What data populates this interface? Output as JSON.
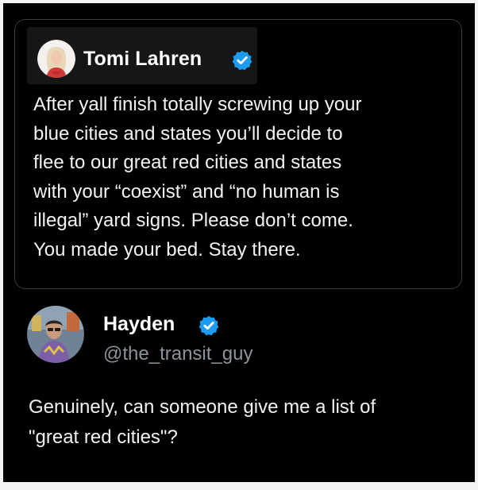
{
  "quoted_tweet": {
    "author_name": "Tomi Lahren",
    "verified": true,
    "text_lines": [
      "After yall finish totally screwing up your",
      "blue cities and states you’ll decide to",
      "flee to our great red cities and states",
      "with your “coexist” and “no human is",
      "illegal” yard signs. Please don’t come.",
      "You made your bed. Stay there."
    ]
  },
  "reply_tweet": {
    "author_name": "Hayden",
    "handle": "@the_transit_guy",
    "verified": true,
    "text_lines": [
      "Genuinely, can someone give me a list of",
      "\"great red cities\"?"
    ]
  },
  "colors": {
    "background": "#000000",
    "verified_badge": "#1d9bf0",
    "handle": "#8b949a",
    "card_border": "#3a3d42"
  },
  "icons": {
    "verified": "verified-badge-icon"
  }
}
